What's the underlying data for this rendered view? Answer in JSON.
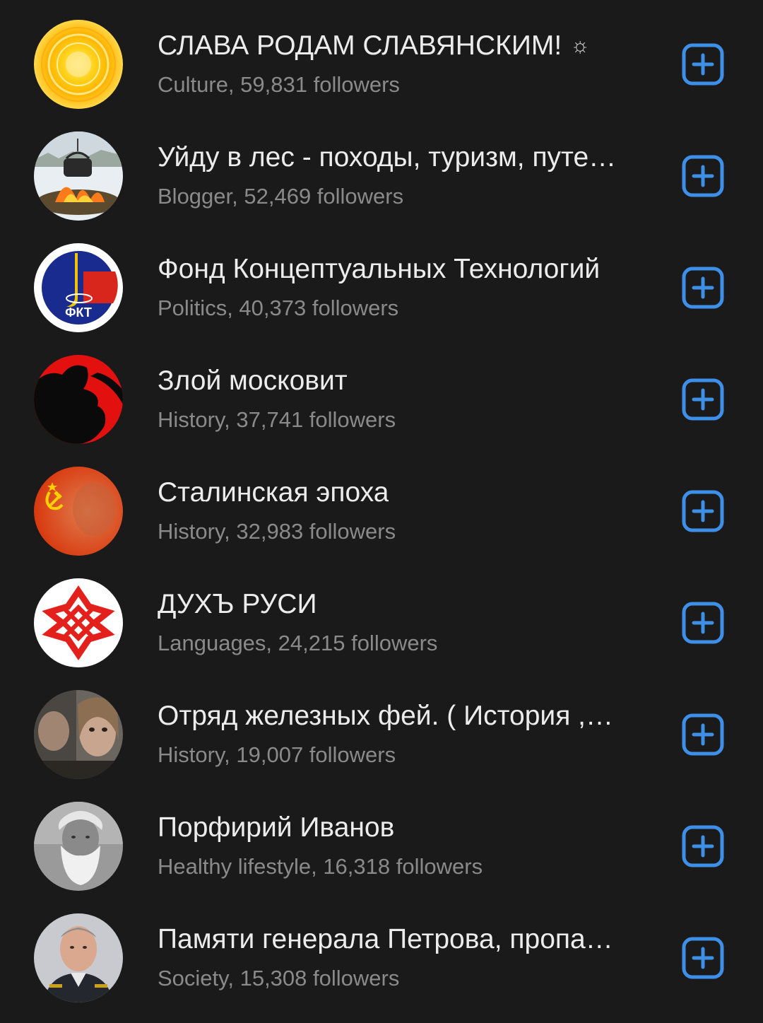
{
  "accent_color": "#3d8fe8",
  "groups": [
    {
      "title": "СЛАВА РОДАМ СЛАВЯНСКИМ!",
      "badge": "☼",
      "category": "Culture",
      "followers": "59,831",
      "subtitle": "Culture, 59,831 followers",
      "avatar": "golden-sun-avatar"
    },
    {
      "title": "Уйду в лес - походы, туризм, путе…",
      "category": "Blogger",
      "followers": "52,469",
      "subtitle": "Blogger, 52,469 followers",
      "avatar": "campfire-kettle-avatar"
    },
    {
      "title": "Фонд Концептуальных Технологий",
      "category": "Politics",
      "followers": "40,373",
      "subtitle": "Politics, 40,373 followers",
      "avatar": "fkt-emblem-avatar",
      "avatar_text": "ФКТ"
    },
    {
      "title": "Злой московит",
      "category": "History",
      "followers": "37,741",
      "subtitle": "History, 37,741 followers",
      "avatar": "red-black-silhouette-avatar"
    },
    {
      "title": "Сталинская эпоха",
      "category": "History",
      "followers": "32,983",
      "subtitle": "History, 32,983 followers",
      "avatar": "hammer-sickle-avatar"
    },
    {
      "title": "ДУХЪ РУСИ",
      "category": "Languages",
      "followers": "24,215",
      "subtitle": "Languages, 24,215 followers",
      "avatar": "red-star-symbol-avatar"
    },
    {
      "title": "Отряд железных фей. ( История ,…",
      "category": "History",
      "followers": "19,007",
      "subtitle": "History, 19,007 followers",
      "avatar": "two-faces-photo-avatar"
    },
    {
      "title": "Порфирий Иванов",
      "category": "Healthy lifestyle",
      "followers": "16,318",
      "subtitle": "Healthy lifestyle, 16,318 followers",
      "avatar": "bearded-man-photo-avatar"
    },
    {
      "title": "Памяти генерала Петрова, пропа…",
      "category": "Society",
      "followers": "15,308",
      "subtitle": "Society, 15,308 followers",
      "avatar": "general-portrait-avatar"
    }
  ]
}
